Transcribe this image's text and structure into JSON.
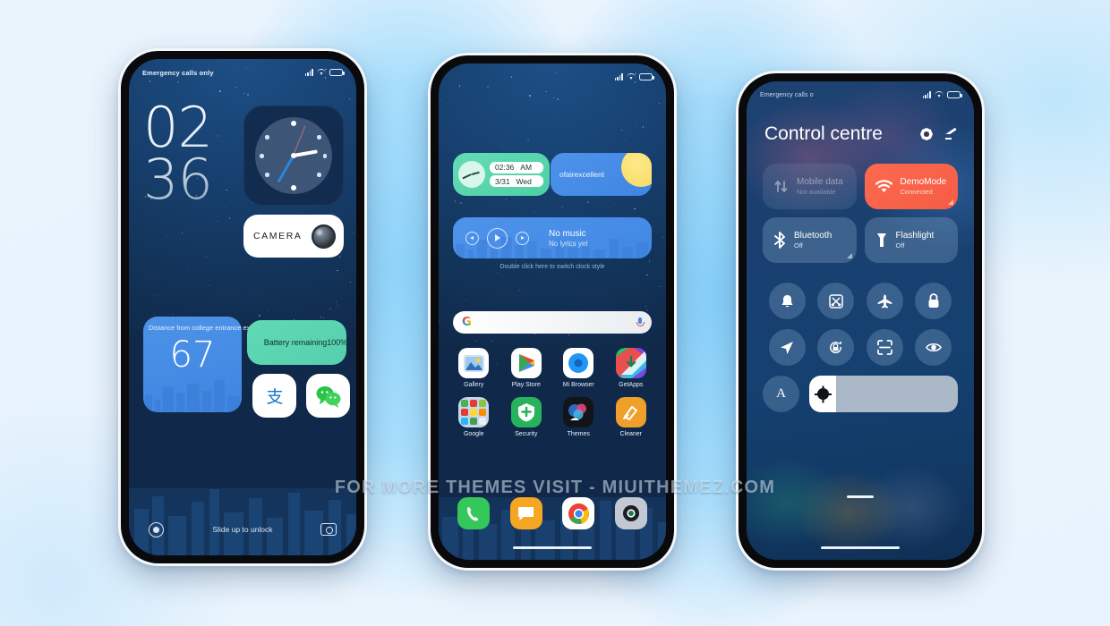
{
  "watermark": "FOR MORE THEMES VISIT - MIUITHEMEZ.COM",
  "colors": {
    "accent_blue": "#4189e4",
    "accent_green": "#55cfae",
    "accent_orange": "#f65c45",
    "wallpaper_dark": "#123358",
    "text_light": "#e8f1fa"
  },
  "lock_screen": {
    "status_bar": {
      "carrier": "Emergency calls only",
      "signal_icon": "signal-bars-icon",
      "wifi_icon": "wifi-icon",
      "battery_icon": "battery-icon"
    },
    "clock": {
      "hours": "02",
      "minutes": "36"
    },
    "clock_widget": {
      "name": "analog-clock-widget"
    },
    "camera_widget": {
      "label": "CAMERA",
      "icon": "camera-lens-icon"
    },
    "distance_widget": {
      "caption": "Distance from college entrance examinationand also",
      "value": "67"
    },
    "battery_widget": {
      "text": "Battery remaining100%"
    },
    "shortcuts": [
      {
        "name": "alipay",
        "icon": "alipay-icon"
      },
      {
        "name": "wechat",
        "icon": "wechat-icon"
      }
    ],
    "bottom": {
      "left_icon": "record-ring-icon",
      "hint": "Slide up to unlock",
      "right_icon": "camera-icon"
    }
  },
  "home_screen": {
    "status_bar": {
      "signal_icon": "signal-bars-icon",
      "wifi_icon": "wifi-icon",
      "battery_icon": "battery-icon"
    },
    "time_widget": {
      "time": "02:36",
      "meridiem": "AM",
      "date": "3/31",
      "weekday": "Wed"
    },
    "weather_widget": {
      "text": "ofairexcellent",
      "icon": "sun-icon"
    },
    "music_widget": {
      "title": "No music",
      "subtitle": "No lyrics yet",
      "prev_icon": "previous-icon",
      "play_icon": "play-icon",
      "next_icon": "next-icon"
    },
    "hint": "Double click here to switch clock style",
    "search": {
      "logo": "google-g-icon",
      "placeholder": "",
      "mic_icon": "microphone-icon"
    },
    "apps": [
      {
        "label": "Gallery",
        "icon": "gallery-icon"
      },
      {
        "label": "Play Store",
        "icon": "play-store-icon"
      },
      {
        "label": "Mi Browser",
        "icon": "mi-browser-icon"
      },
      {
        "label": "GetApps",
        "icon": "getapps-icon"
      },
      {
        "label": "Google",
        "icon": "google-folder-icon"
      },
      {
        "label": "Security",
        "icon": "security-icon"
      },
      {
        "label": "Themes",
        "icon": "themes-icon"
      },
      {
        "label": "Cleaner",
        "icon": "cleaner-icon"
      }
    ],
    "dock": [
      {
        "label": "Phone",
        "icon": "phone-icon"
      },
      {
        "label": "Messages",
        "icon": "messages-icon"
      },
      {
        "label": "Chrome",
        "icon": "chrome-icon"
      },
      {
        "label": "Camera",
        "icon": "camera-icon"
      }
    ]
  },
  "control_centre": {
    "status_bar": {
      "carrier": "Emergency calls o",
      "signal_icon": "signal-bars-icon",
      "wifi_icon": "wifi-icon",
      "battery_icon": "battery-icon"
    },
    "title": "Control centre",
    "actions": [
      {
        "name": "settings",
        "icon": "gear-icon"
      },
      {
        "name": "edit",
        "icon": "pencil-icon"
      }
    ],
    "tiles": [
      {
        "title": "Mobile data",
        "status": "Not available",
        "icon": "mobile-data-icon",
        "state": "disabled"
      },
      {
        "title": "DemoMode",
        "status": "Connected",
        "icon": "wifi-icon",
        "state": "on"
      },
      {
        "title": "Bluetooth",
        "status": "Off",
        "icon": "bluetooth-icon",
        "state": "off"
      },
      {
        "title": "Flashlight",
        "status": "Off",
        "icon": "flashlight-icon",
        "state": "off"
      }
    ],
    "toggles": [
      {
        "name": "silent",
        "icon": "bell-icon"
      },
      {
        "name": "screenshot",
        "icon": "screenshot-icon"
      },
      {
        "name": "airplane-mode",
        "icon": "airplane-icon"
      },
      {
        "name": "lock-screen",
        "icon": "lock-icon"
      },
      {
        "name": "location",
        "icon": "location-arrow-icon"
      },
      {
        "name": "auto-rotate",
        "icon": "rotation-lock-icon"
      },
      {
        "name": "scanner",
        "icon": "scan-frame-icon"
      },
      {
        "name": "reading-mode",
        "icon": "eye-icon"
      }
    ],
    "brightness": {
      "auto_label": "A",
      "icon": "brightness-sun-icon",
      "level": 22
    }
  }
}
